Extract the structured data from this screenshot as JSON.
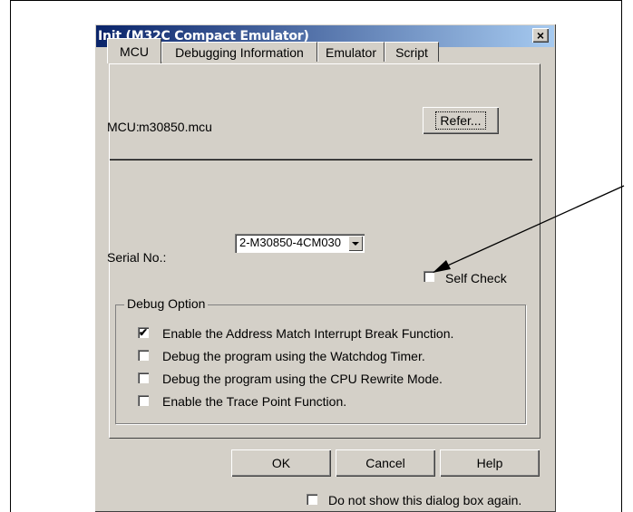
{
  "dialog": {
    "title": "Init (M32C Compact Emulator)",
    "close_icon": "×"
  },
  "tabs": [
    {
      "label": "MCU",
      "active": true
    },
    {
      "label": "Debugging Information",
      "active": false
    },
    {
      "label": "Emulator",
      "active": false
    },
    {
      "label": "Script",
      "active": false
    }
  ],
  "mcu": {
    "label": "MCU:",
    "value": "m30850.mcu",
    "refer_button": "Refer..."
  },
  "serial": {
    "label": "Serial No.:",
    "selected": "2-M30850-4CM030"
  },
  "self_check": {
    "label": "Self Check",
    "checked": false
  },
  "debug_option": {
    "title": "Debug Option",
    "options": [
      {
        "label": "Enable the Address Match Interrupt Break Function.",
        "checked": true,
        "check_mark": "✔"
      },
      {
        "label": "Debug the program using the Watchdog Timer.",
        "checked": false,
        "check_mark": ""
      },
      {
        "label": "Debug the program using the CPU Rewrite Mode.",
        "checked": false,
        "check_mark": ""
      },
      {
        "label": "Enable the Trace Point Function.",
        "checked": false,
        "check_mark": ""
      }
    ]
  },
  "buttons": {
    "ok": "OK",
    "cancel": "Cancel",
    "help": "Help"
  },
  "dont_show": {
    "label": "Do not show this dialog box again.",
    "checked": false
  }
}
